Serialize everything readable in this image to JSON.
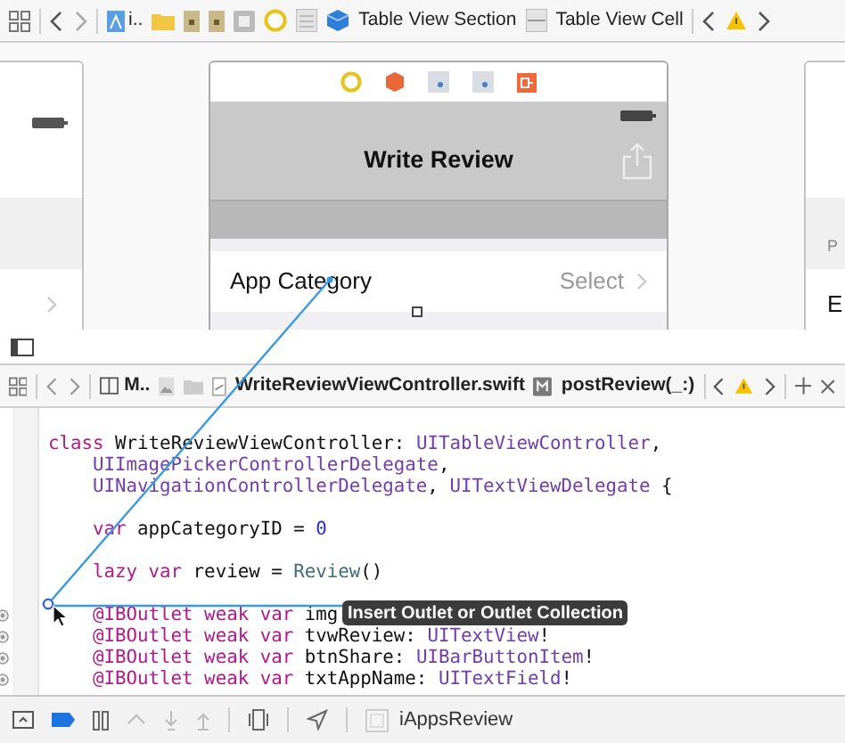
{
  "canvas_jump_bar": {
    "crumbs": [
      "i..",
      "Table View Section",
      "Table View Cell"
    ]
  },
  "storyboard": {
    "scene": {
      "title": "Write Review",
      "cell": {
        "label": "App Category",
        "detail": "Select"
      }
    },
    "right_scene": {
      "header": "P",
      "cell": "E"
    }
  },
  "editor_jump_bar": {
    "crumbs": [
      "M..",
      "WriteReviewViewController.swift",
      "postReview(_:)"
    ]
  },
  "code": {
    "blocks": [
      {
        "lines": [
          {
            "outlet": false,
            "indented": false,
            "tokens": [
              {
                "kind": "keyword",
                "text": "class"
              },
              {
                "kind": "plain",
                "text": " WriteReviewViewController: "
              },
              {
                "kind": "type",
                "text": "UITableViewController"
              },
              {
                "kind": "plain",
                "text": ","
              }
            ]
          },
          {
            "outlet": false,
            "indented": true,
            "tokens": [
              {
                "kind": "type",
                "text": "UIImagePickerControllerDelegate"
              },
              {
                "kind": "plain",
                "text": ","
              }
            ]
          },
          {
            "outlet": false,
            "indented": true,
            "tokens": [
              {
                "kind": "type",
                "text": "UINavigationControllerDelegate"
              },
              {
                "kind": "plain",
                "text": ", "
              },
              {
                "kind": "type",
                "text": "UITextViewDelegate"
              },
              {
                "kind": "plain",
                "text": " {"
              }
            ]
          }
        ]
      },
      {
        "lines": [
          {
            "outlet": false,
            "indented": true,
            "tokens": [
              {
                "kind": "keyword",
                "text": "var"
              },
              {
                "kind": "plain",
                "text": " appCategoryID = "
              },
              {
                "kind": "number",
                "text": "0"
              }
            ]
          }
        ]
      },
      {
        "lines": [
          {
            "outlet": false,
            "indented": true,
            "tokens": [
              {
                "kind": "keyword",
                "text": "lazy var"
              },
              {
                "kind": "plain",
                "text": " review = "
              },
              {
                "kind": "project",
                "text": "Review"
              },
              {
                "kind": "plain",
                "text": "()"
              }
            ]
          }
        ]
      },
      {
        "lines": [
          {
            "outlet": true,
            "indented": true,
            "tokens": [
              {
                "kind": "keyword",
                "text": "@IBOutlet weak var"
              },
              {
                "kind": "plain",
                "text": " img"
              }
            ]
          },
          {
            "outlet": true,
            "indented": true,
            "tokens": [
              {
                "kind": "keyword",
                "text": "@IBOutlet weak var"
              },
              {
                "kind": "plain",
                "text": " tvwReview: "
              },
              {
                "kind": "type",
                "text": "UITextView"
              },
              {
                "kind": "plain",
                "text": "!"
              }
            ]
          },
          {
            "outlet": true,
            "indented": true,
            "tokens": [
              {
                "kind": "keyword",
                "text": "@IBOutlet weak var"
              },
              {
                "kind": "plain",
                "text": " btnShare: "
              },
              {
                "kind": "type",
                "text": "UIBarButtonItem"
              },
              {
                "kind": "plain",
                "text": "!"
              }
            ]
          },
          {
            "outlet": true,
            "indented": true,
            "tokens": [
              {
                "kind": "keyword",
                "text": "@IBOutlet weak var"
              },
              {
                "kind": "plain",
                "text": " txtAppName: "
              },
              {
                "kind": "type",
                "text": "UITextField"
              },
              {
                "kind": "plain",
                "text": "!"
              }
            ]
          }
        ]
      }
    ]
  },
  "tooltip": "Insert Outlet or Outlet Collection",
  "debug_bar": {
    "scheme": "iAppsReview"
  }
}
